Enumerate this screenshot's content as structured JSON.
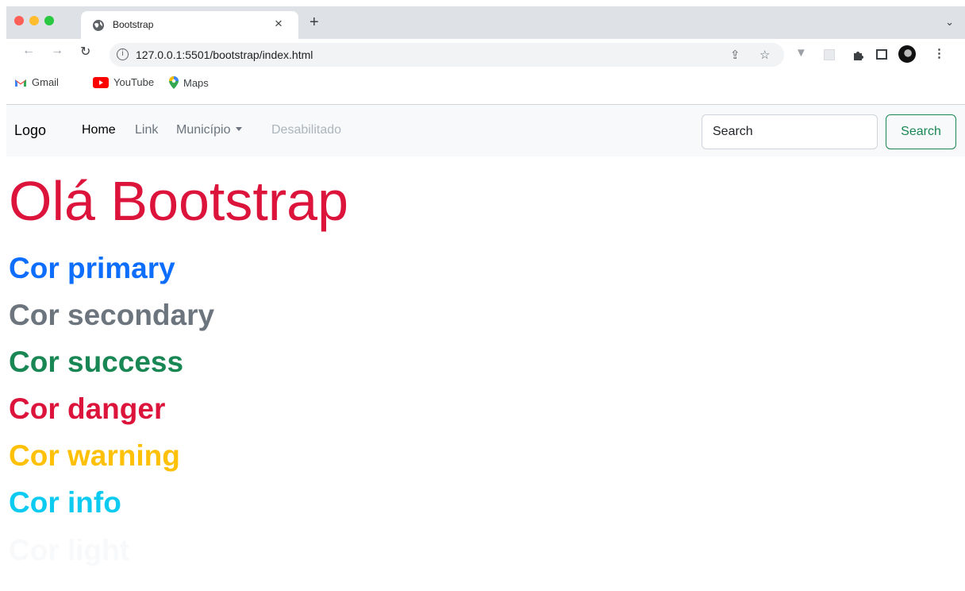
{
  "browser": {
    "tab_title": "Bootstrap",
    "tab_close": "×",
    "new_tab": "+",
    "tab_search": "⌄",
    "url": "127.0.0.1:5501/bootstrap/index.html",
    "bookmarks": [
      "Gmail",
      "YouTube",
      "Maps"
    ]
  },
  "navbar": {
    "brand": "Logo",
    "links": [
      "Home",
      "Link",
      "Município",
      "Desabilitado"
    ],
    "search_placeholder": "Search",
    "search_button": "Search"
  },
  "content": {
    "heading": "Olá Bootstrap",
    "colors": [
      {
        "text": "Cor primary",
        "color": "#0d6efd"
      },
      {
        "text": "Cor secondary",
        "color": "#6c757d"
      },
      {
        "text": "Cor success",
        "color": "#198754"
      },
      {
        "text": "Cor danger",
        "color": "#dc143c"
      },
      {
        "text": "Cor warning",
        "color": "#ffc107"
      },
      {
        "text": "Cor info",
        "color": "#0dcaf0"
      },
      {
        "text": "Cor light",
        "color": "#f8f9fa"
      }
    ]
  }
}
